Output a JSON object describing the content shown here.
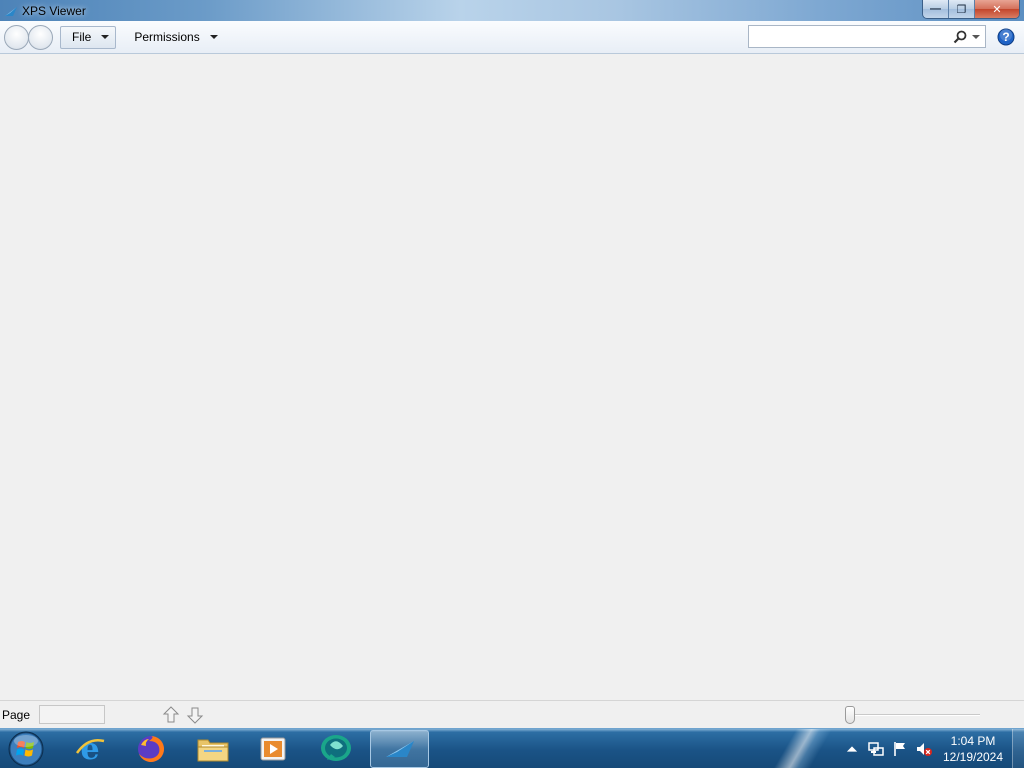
{
  "window": {
    "title": "XPS Viewer",
    "controls": {
      "minimize": "—",
      "restore": "❐",
      "close": "✕"
    }
  },
  "toolbar": {
    "back_icon": "back-arrow-icon",
    "forward_icon": "forward-arrow-icon",
    "file_label": "File",
    "permissions_label": "Permissions",
    "search_value": "",
    "search_placeholder": "",
    "help_icon": "help-icon"
  },
  "statusbar": {
    "page_label": "Page",
    "page_value": "",
    "zoom_level": 0
  },
  "taskbar": {
    "apps": [
      {
        "name": "Internet Explorer",
        "icon": "ie-icon"
      },
      {
        "name": "Firefox",
        "icon": "firefox-icon"
      },
      {
        "name": "Windows Explorer",
        "icon": "folder-icon"
      },
      {
        "name": "Media Player",
        "icon": "media-player-icon"
      },
      {
        "name": "Messenger",
        "icon": "messenger-icon"
      },
      {
        "name": "XPS Viewer",
        "icon": "xps-viewer-icon",
        "active": true
      }
    ],
    "clock_time": "1:04 PM",
    "clock_date": "12/19/2024"
  },
  "colors": {
    "accent": "#1a5386",
    "content_bg": "#f0f0f0",
    "close_button": "#c3452b",
    "help": "#1f63c6"
  }
}
